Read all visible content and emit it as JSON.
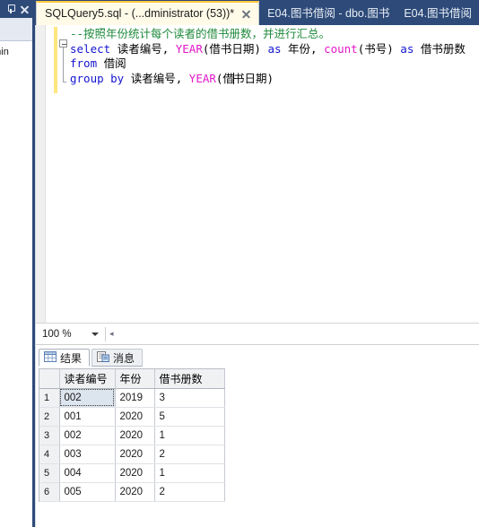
{
  "left_panel": {
    "name": "docked-panel",
    "pin_icon": "pin-icon",
    "close_icon": "close-icon",
    "clipped_text": "dmin"
  },
  "tabs": [
    {
      "label": "SQLQuery5.sql - (...dministrator (53))*",
      "active": true,
      "closeable": true
    },
    {
      "label": "E04.图书借阅 - dbo.图书",
      "active": false,
      "closeable": false
    },
    {
      "label": "E04.图书借阅",
      "active": false,
      "closeable": false
    }
  ],
  "editor": {
    "lines": [
      {
        "tokens": [
          {
            "t": "--按照年份统计每个读者的借书册数，并进行汇总。",
            "c": "comment"
          }
        ]
      },
      {
        "tokens": [
          {
            "t": "select ",
            "c": "keyword"
          },
          {
            "t": "读者编号, ",
            "c": "plain"
          },
          {
            "t": "YEAR",
            "c": "func"
          },
          {
            "t": "(借书日期) ",
            "c": "plain"
          },
          {
            "t": "as ",
            "c": "keyword"
          },
          {
            "t": "年份, ",
            "c": "plain"
          },
          {
            "t": "count",
            "c": "func"
          },
          {
            "t": "(书号) ",
            "c": "plain"
          },
          {
            "t": "as ",
            "c": "keyword"
          },
          {
            "t": "借书册数",
            "c": "plain"
          }
        ]
      },
      {
        "tokens": [
          {
            "t": "from ",
            "c": "keyword"
          },
          {
            "t": "借阅",
            "c": "plain"
          }
        ]
      },
      {
        "tokens": [
          {
            "t": "group by ",
            "c": "keyword"
          },
          {
            "t": "读者编号, ",
            "c": "plain"
          },
          {
            "t": "YEAR",
            "c": "func"
          },
          {
            "t": "(借",
            "c": "plain"
          },
          {
            "t": "CARET",
            "c": "caret"
          },
          {
            "t": "书日期)",
            "c": "plain"
          }
        ]
      }
    ],
    "colors": {
      "comment": "#1f8a3c",
      "keyword": "#1414d0",
      "function": "#e219c8",
      "plain": "#000000",
      "change_bar": "#ffe680"
    }
  },
  "zoom_bar": {
    "level": "100 %",
    "dropdown_icon": "chevron-down-icon",
    "nav_icon": "nav-arrow-icon"
  },
  "results": {
    "tabs": [
      {
        "label": "结果",
        "icon": "grid-icon",
        "active": true
      },
      {
        "label": "消息",
        "icon": "message-icon",
        "active": false
      }
    ],
    "grid": {
      "corner_header": "",
      "columns": [
        "读者编号",
        "年份",
        "借书册数"
      ],
      "rows": [
        {
          "num": "1",
          "cells": [
            "002",
            "2019",
            "3"
          ],
          "selected_col": 0
        },
        {
          "num": "2",
          "cells": [
            "001",
            "2020",
            "5"
          ],
          "selected_col": -1
        },
        {
          "num": "3",
          "cells": [
            "002",
            "2020",
            "1"
          ],
          "selected_col": -1
        },
        {
          "num": "4",
          "cells": [
            "003",
            "2020",
            "2"
          ],
          "selected_col": -1
        },
        {
          "num": "5",
          "cells": [
            "004",
            "2020",
            "1"
          ],
          "selected_col": -1
        },
        {
          "num": "6",
          "cells": [
            "005",
            "2020",
            "2"
          ],
          "selected_col": -1
        }
      ]
    }
  },
  "theme": {
    "titlebar_blue": "#2d4a78",
    "active_tab_bg": "#fffbe8",
    "active_tab_accent": "#ffc83d"
  }
}
